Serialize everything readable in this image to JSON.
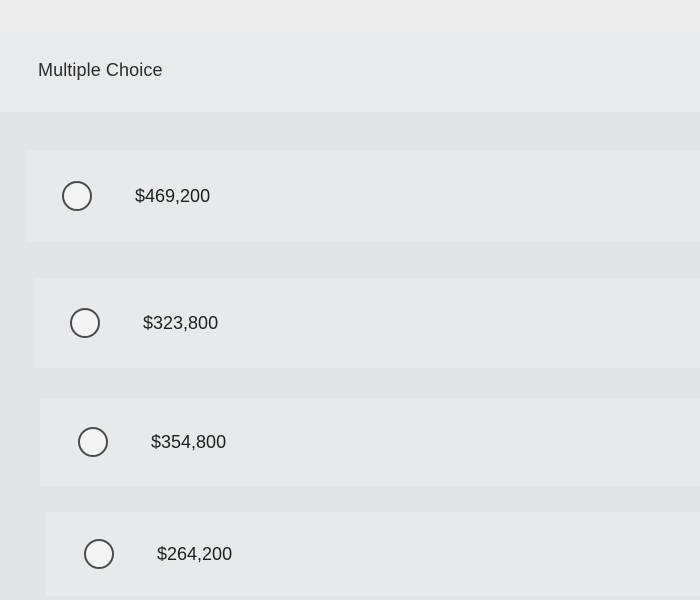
{
  "question": {
    "title": "Multiple Choice"
  },
  "choices": [
    {
      "label": "$469,200"
    },
    {
      "label": "$323,800"
    },
    {
      "label": "$354,800"
    },
    {
      "label": "$264,200"
    }
  ]
}
